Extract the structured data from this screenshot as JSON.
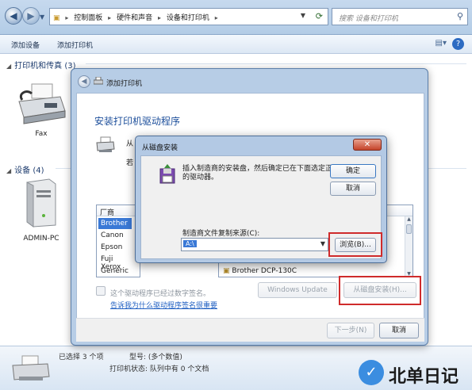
{
  "explorer": {
    "breadcrumbs": [
      "控制面板",
      "硬件和声音",
      "设备和打印机"
    ],
    "search_placeholder": "搜索 设备和打印机",
    "toolbar": {
      "add_device": "添加设备",
      "add_printer": "添加打印机"
    },
    "groups": {
      "printers": "打印机和传真 (3)",
      "devices": "设备 (4)"
    },
    "device_labels": {
      "fax": "Fax",
      "pc": "ADMIN-PC"
    },
    "status": {
      "selected": "已选择 3 个项",
      "model": "型号: (多个数值)",
      "state": "打印机状态: 队列中有 0 个文档"
    }
  },
  "wizard": {
    "title": "添加打印机",
    "heading": "安装打印机驱动程序",
    "desc_fragment": "从",
    "desc_fragment2": "若",
    "manufacturer_header": "厂商",
    "manufacturers": [
      "Brother",
      "Canon",
      "Epson",
      "Fuji Xerox",
      "Generic"
    ],
    "selected_manufacturer": "Brother",
    "printer_item": "Brother DCP-130C",
    "signed_text": "这个驱动程序已经过数字签名。",
    "signing_link": "告诉我为什么驱动程序签名很重要",
    "windows_update": "Windows Update",
    "from_disk": "从磁盘安装(H)...",
    "next": "下一步(N)",
    "cancel": "取消"
  },
  "disk_dialog": {
    "title": "从磁盘安装",
    "message": "插入制造商的安装盘，然后确定已在下面选定正确的驱动器。",
    "ok": "确定",
    "cancel": "取消",
    "source_label": "制造商文件复制来源(C):",
    "source_value": "A:\\",
    "browse": "浏览(B)..."
  },
  "watermark": {
    "text": "北单日记"
  }
}
